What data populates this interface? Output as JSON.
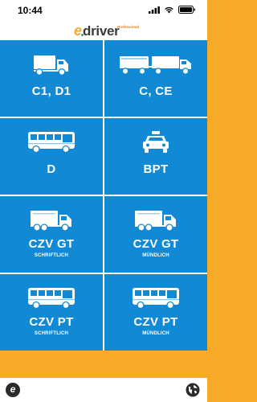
{
  "status_bar": {
    "time": "10:44"
  },
  "header": {
    "logo_e": "e",
    "logo_driver": "driver",
    "logo_tag": "Professional"
  },
  "tiles": [
    {
      "title": "C1, D1",
      "subtitle": "",
      "icon": "small-truck-icon"
    },
    {
      "title": "C, CE",
      "subtitle": "",
      "icon": "truck-trailer-icon"
    },
    {
      "title": "D",
      "subtitle": "",
      "icon": "bus-icon"
    },
    {
      "title": "BPT",
      "subtitle": "",
      "icon": "taxi-icon"
    },
    {
      "title": "CZV GT",
      "subtitle": "SCHRIFTLICH",
      "icon": "truck-icon"
    },
    {
      "title": "CZV GT",
      "subtitle": "MÜNDLICH",
      "icon": "truck-icon"
    },
    {
      "title": "CZV PT",
      "subtitle": "SCHRIFTLICH",
      "icon": "bus-icon"
    },
    {
      "title": "CZV PT",
      "subtitle": "MÜNDLICH",
      "icon": "bus-icon"
    }
  ],
  "bottom_bar": {
    "app_badge": "e",
    "globe_icon": "globe-icon"
  },
  "colors": {
    "tile": "#1189d4",
    "accent": "#f7a928",
    "background": "#ffffff"
  }
}
